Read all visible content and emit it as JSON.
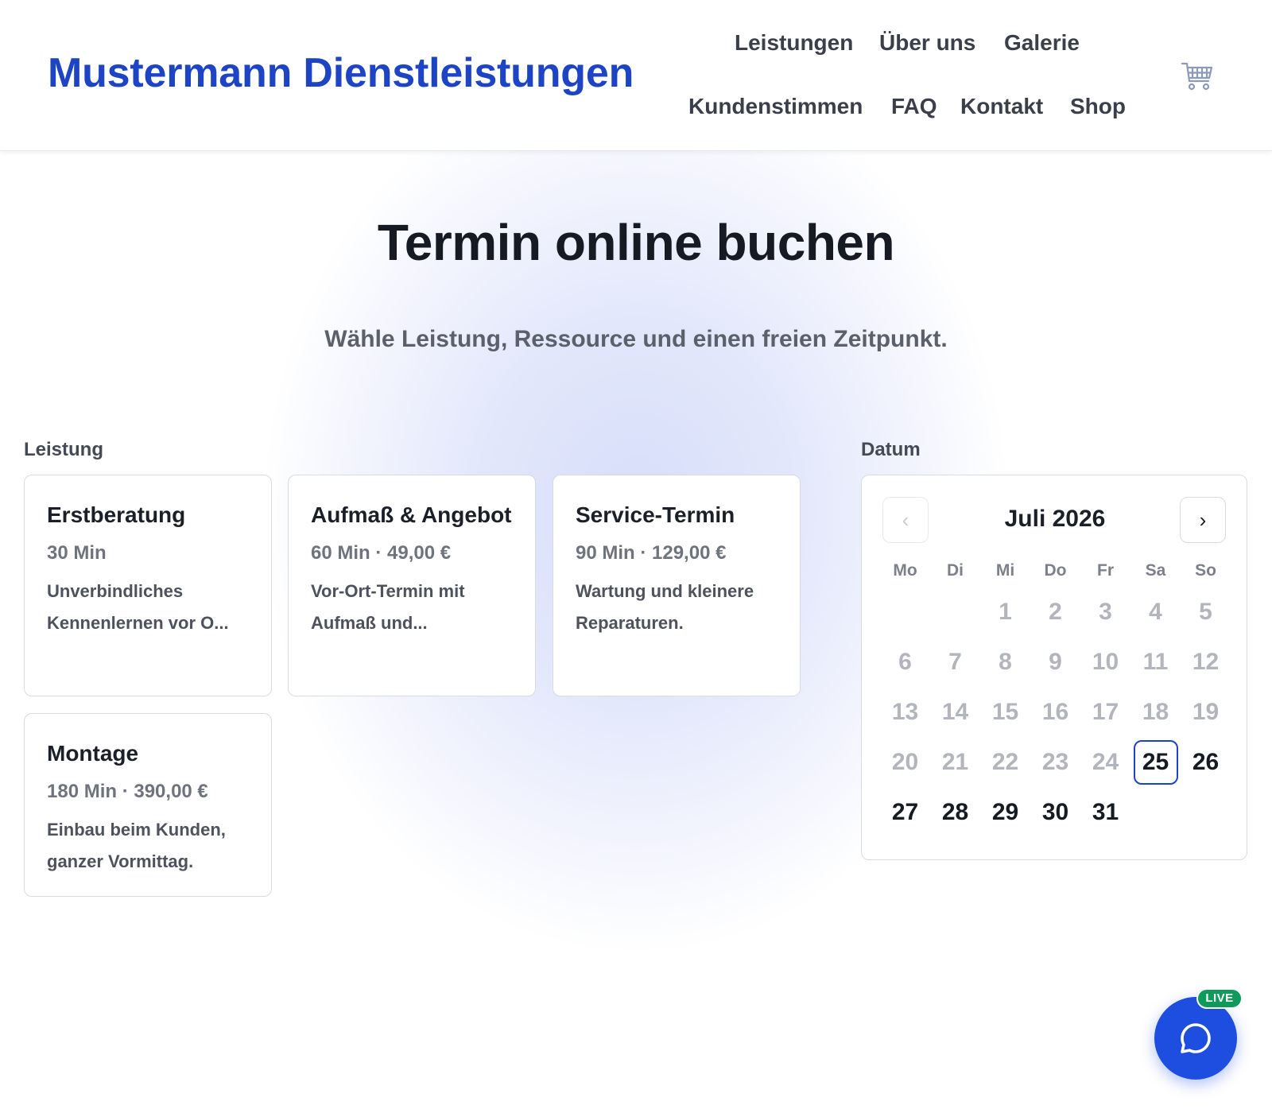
{
  "header": {
    "brand": "Mustermann Dienstleistungen",
    "nav": [
      "Leistungen",
      "Über uns",
      "Galerie",
      "Kundenstimmen",
      "FAQ",
      "Kontakt",
      "Shop"
    ],
    "cart_icon": "cart-icon"
  },
  "hero": {
    "title": "Termin online buchen",
    "subtitle": "Wähle Leistung, Ressource und einen freien Zeitpunkt."
  },
  "services": {
    "label": "Leistung",
    "items": [
      {
        "title": "Erstberatung",
        "meta": "30 Min",
        "desc": "Unverbindliches Kennenlernen vor O..."
      },
      {
        "title": "Aufmaß & Angebot",
        "meta": "60 Min · 49,00 €",
        "desc": "Vor-Ort-Termin mit Aufmaß und..."
      },
      {
        "title": "Service-Termin",
        "meta": "90 Min · 129,00 €",
        "desc": "Wartung und kleinere Reparaturen."
      },
      {
        "title": "Montage",
        "meta": "180 Min · 390,00 €",
        "desc": "Einbau beim Kunden, ganzer Vormittag."
      }
    ]
  },
  "calendar": {
    "label": "Datum",
    "month": "Juli 2026",
    "prev": "‹",
    "next": "›",
    "weekdays": [
      "Mo",
      "Di",
      "Mi",
      "Do",
      "Fr",
      "Sa",
      "So"
    ],
    "leading_blanks": 2,
    "days_in_month": 31,
    "first_available": 25,
    "selected": 25
  },
  "chat": {
    "badge": "LIVE",
    "icon": "chat-bubble-icon",
    "accent": "#1d4ee0",
    "badge_color": "#0e9a5b"
  },
  "colors": {
    "brand": "#1d44c4",
    "muted_day": "#b2b5bc",
    "border": "#d8dbe2"
  }
}
